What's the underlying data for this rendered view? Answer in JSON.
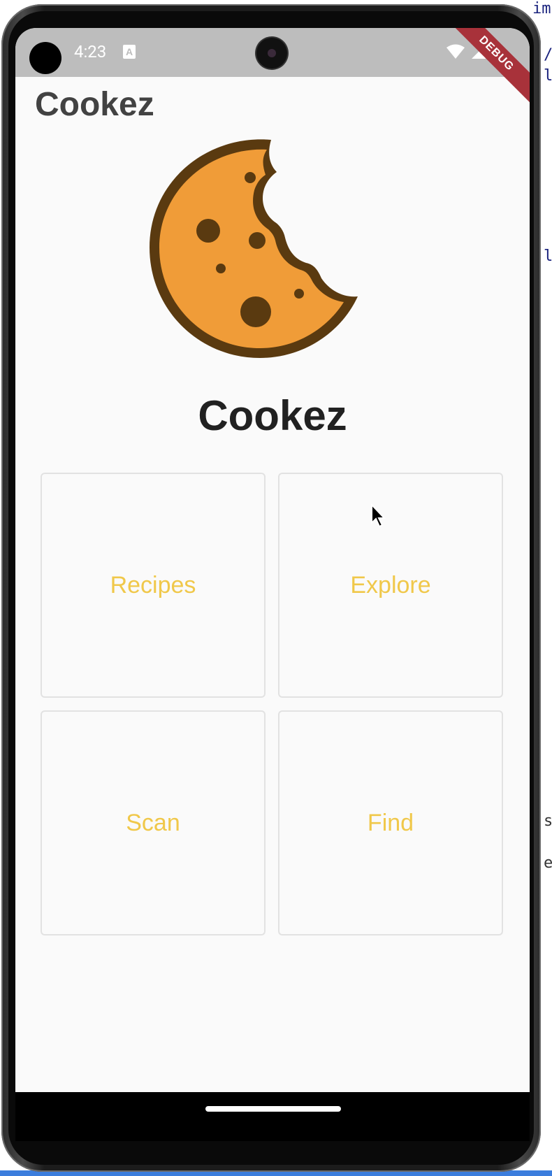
{
  "status_bar": {
    "time": "4:23",
    "notification_icon": "A",
    "debug_label": "DEBUG"
  },
  "app_bar": {
    "title": "Cookez"
  },
  "brand": {
    "name": "Cookez",
    "logo_icon": "cookie-icon"
  },
  "tiles": [
    {
      "label": "Recipes"
    },
    {
      "label": "Explore"
    },
    {
      "label": "Scan"
    },
    {
      "label": "Find"
    }
  ],
  "colors": {
    "tile_text": "#f0c84a",
    "cookie_fill": "#f09c38",
    "cookie_outline": "#5a3a10",
    "status_bar_bg": "#bdbdbd"
  },
  "ide_background": {
    "snippets": [
      "im",
      "/",
      "l",
      "l",
      "s",
      "e"
    ]
  }
}
